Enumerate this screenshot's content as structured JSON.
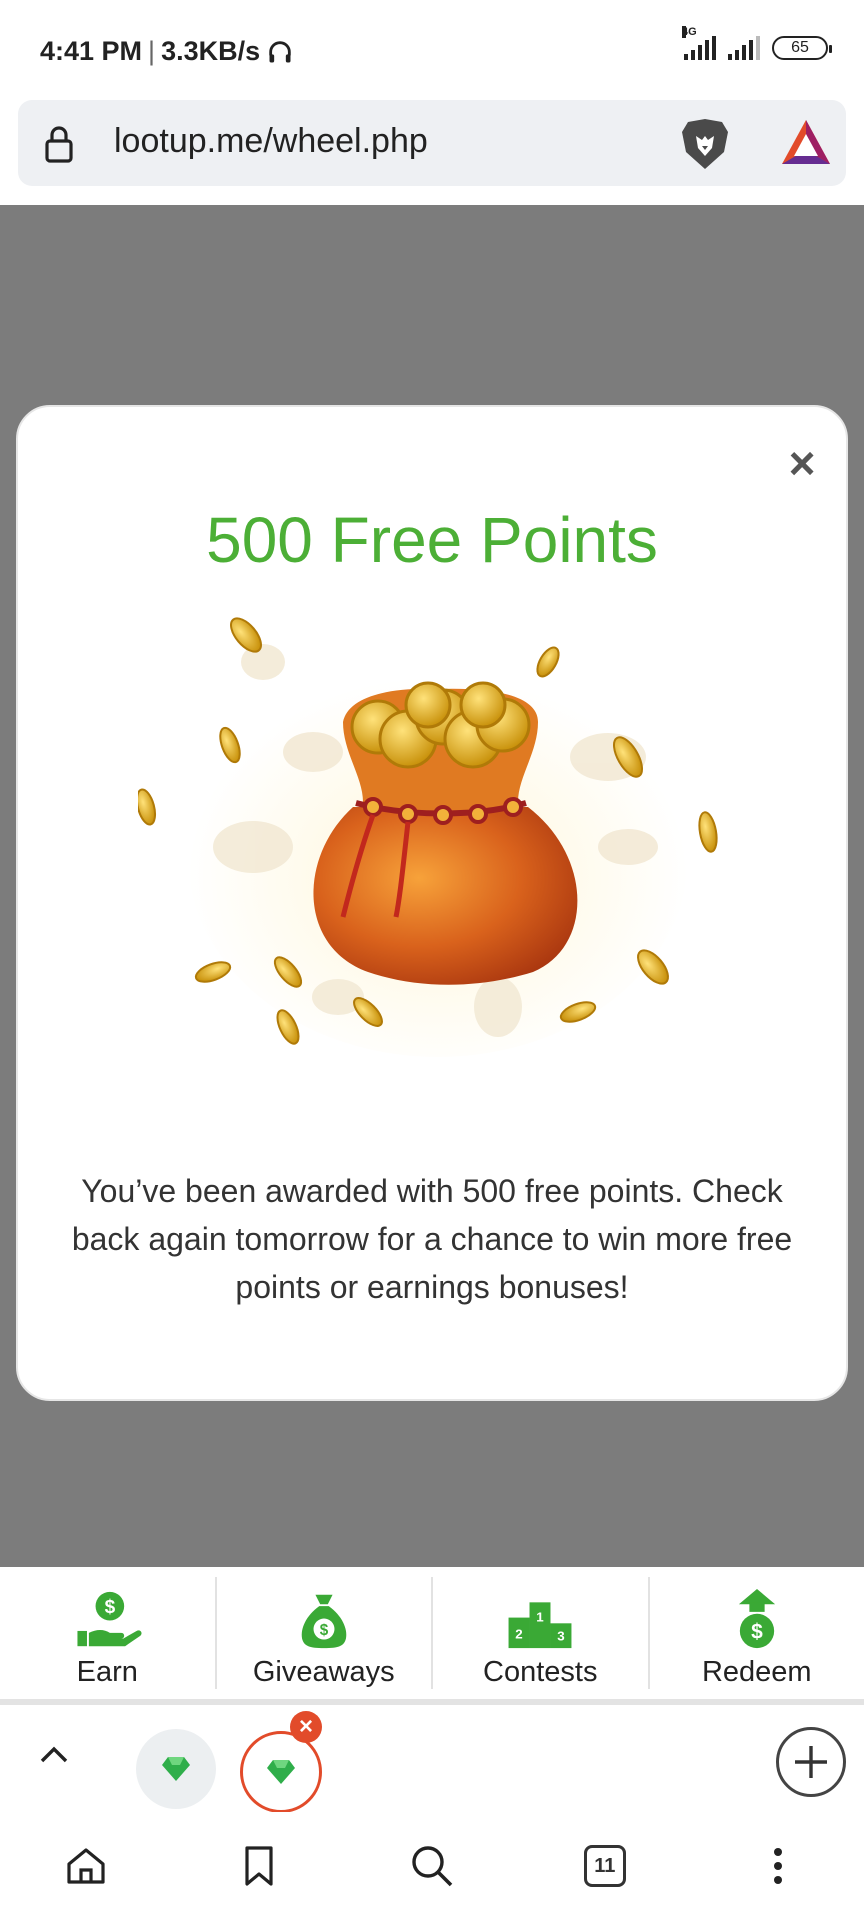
{
  "status_bar": {
    "time": "4:41 PM",
    "speed": "3.3KB/s",
    "network": "4G",
    "battery": "65"
  },
  "address_bar": {
    "url": "lootup.me/wheel.php"
  },
  "modal": {
    "title": "500 Free Points",
    "message": "You’ve been awarded with 500 free points. Check back again tomorrow for a chance to win more free points or earnings bonuses!",
    "close_symbol": "×"
  },
  "bottom_nav": {
    "items": [
      {
        "label": "Earn",
        "icon": "earn-hand-dollar-icon"
      },
      {
        "label": "Giveaways",
        "icon": "money-bag-icon"
      },
      {
        "label": "Contests",
        "icon": "podium-icon",
        "podium_numbers": [
          "2",
          "1",
          "3"
        ]
      },
      {
        "label": "Redeem",
        "icon": "redeem-arrow-dollar-icon"
      }
    ]
  },
  "tab_strip": {
    "close_symbol": "×"
  },
  "toolbar": {
    "tab_count": "11"
  },
  "colors": {
    "accent_green": "#4caf36",
    "modal_title": "#4caf36",
    "tab_active_border": "#e24b2a"
  }
}
